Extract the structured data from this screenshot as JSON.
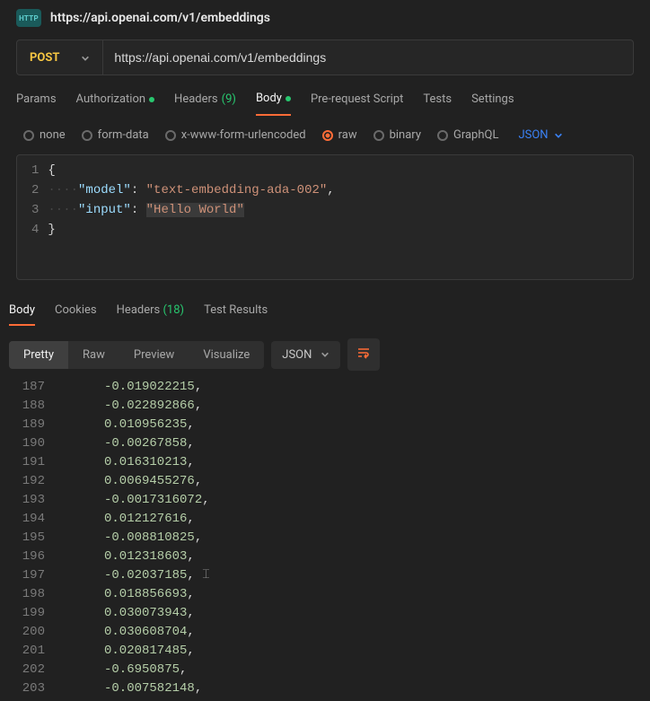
{
  "header": {
    "http_badge": "HTTP",
    "title": "https://api.openai.com/v1/embeddings"
  },
  "request": {
    "method": "POST",
    "url": "https://api.openai.com/v1/embeddings"
  },
  "tabs": {
    "params": "Params",
    "authorization": "Authorization",
    "headers_label": "Headers",
    "headers_count": "(9)",
    "body": "Body",
    "prerequest": "Pre-request Script",
    "tests": "Tests",
    "settings": "Settings"
  },
  "body_types": {
    "none": "none",
    "form_data": "form-data",
    "xform": "x-www-form-urlencoded",
    "raw": "raw",
    "binary": "binary",
    "graphql": "GraphQL",
    "json_label": "JSON"
  },
  "editor": {
    "lines": [
      "1",
      "2",
      "3",
      "4"
    ],
    "key_model": "\"model\"",
    "val_model": "\"text-embedding-ada-002\"",
    "key_input": "\"input\"",
    "val_input": "\"Hello World\""
  },
  "response": {
    "tabs": {
      "body": "Body",
      "cookies": "Cookies",
      "headers_label": "Headers",
      "headers_count": "(18)",
      "test_results": "Test Results"
    },
    "views": {
      "pretty": "Pretty",
      "raw": "Raw",
      "preview": "Preview",
      "visualize": "Visualize"
    },
    "format_label": "JSON",
    "lines": [
      {
        "n": "187",
        "v": "-0.019022215"
      },
      {
        "n": "188",
        "v": "-0.022892866"
      },
      {
        "n": "189",
        "v": "0.010956235"
      },
      {
        "n": "190",
        "v": "-0.00267858"
      },
      {
        "n": "191",
        "v": "0.016310213"
      },
      {
        "n": "192",
        "v": "0.0069455276"
      },
      {
        "n": "193",
        "v": "-0.0017316072"
      },
      {
        "n": "194",
        "v": "0.012127616"
      },
      {
        "n": "195",
        "v": "-0.008810825"
      },
      {
        "n": "196",
        "v": "0.012318603"
      },
      {
        "n": "197",
        "v": "-0.02037185"
      },
      {
        "n": "198",
        "v": "0.018856693"
      },
      {
        "n": "199",
        "v": "0.030073943"
      },
      {
        "n": "200",
        "v": "0.030608704"
      },
      {
        "n": "201",
        "v": "0.020817485"
      },
      {
        "n": "202",
        "v": "-0.6950875"
      },
      {
        "n": "203",
        "v": "-0.007582148"
      }
    ]
  }
}
